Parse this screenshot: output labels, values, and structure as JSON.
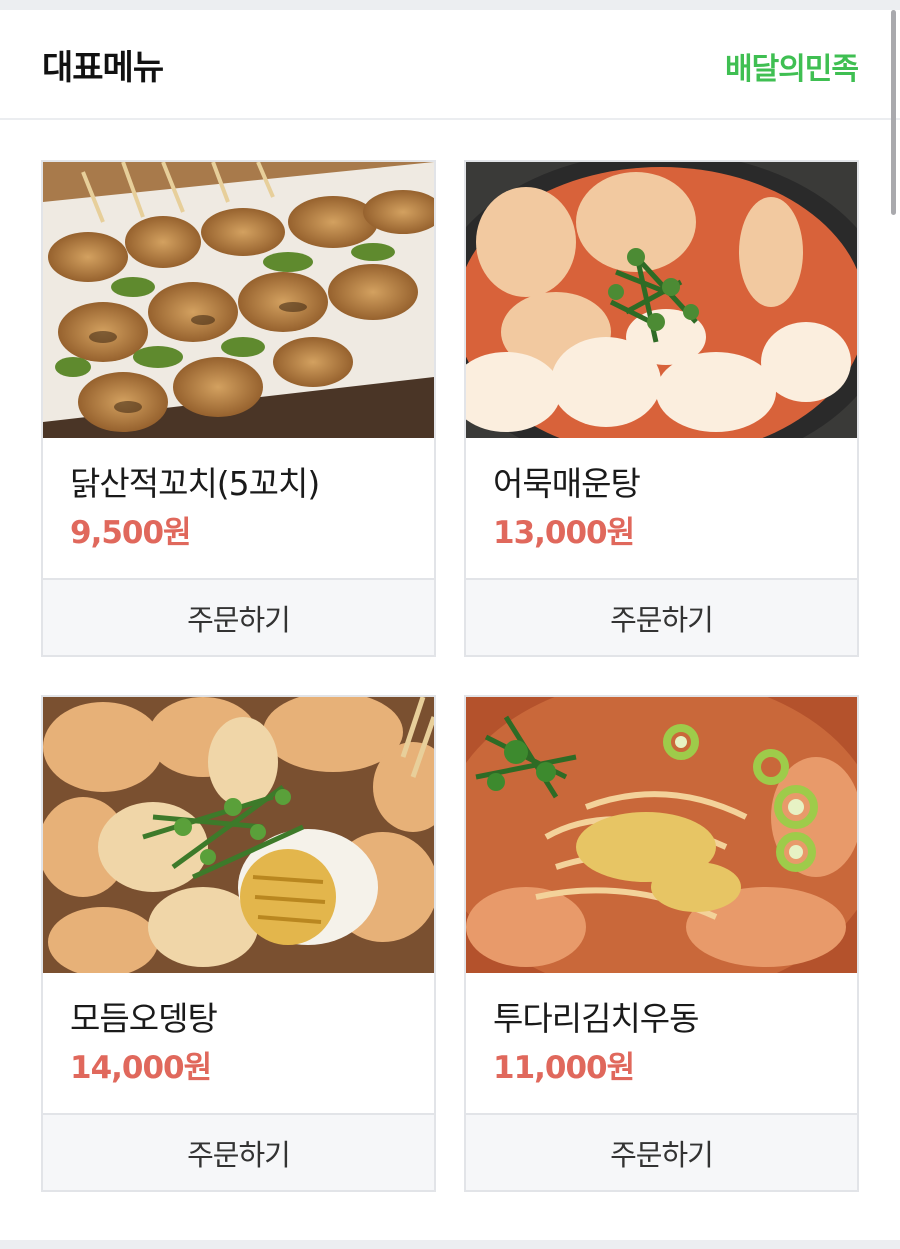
{
  "header": {
    "title": "대표메뉴",
    "brand": "배달의민족"
  },
  "colors": {
    "brand": "#3fbf52",
    "price": "#e0685c",
    "button_bg": "#f6f7f9"
  },
  "menu": [
    {
      "name": "닭산적꼬치(5꼬치)",
      "price": "9,500원",
      "order_label": "주문하기",
      "photo": "chicken-skewers"
    },
    {
      "name": "어묵매운탕",
      "price": "13,000원",
      "order_label": "주문하기",
      "photo": "spicy-fishcake-stew"
    },
    {
      "name": "모듬오뎅탕",
      "price": "14,000원",
      "order_label": "주문하기",
      "photo": "assorted-oden-soup"
    },
    {
      "name": "투다리김치우동",
      "price": "11,000원",
      "order_label": "주문하기",
      "photo": "kimchi-udon"
    }
  ]
}
